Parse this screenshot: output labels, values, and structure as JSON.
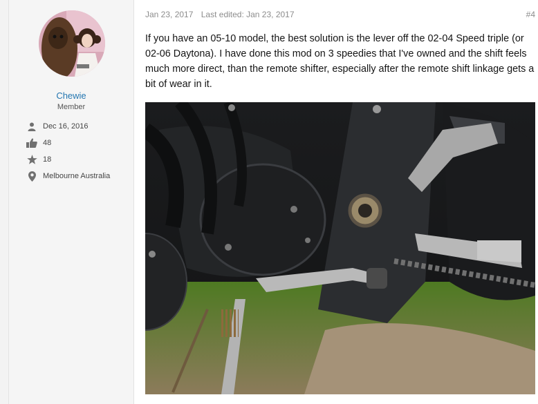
{
  "user": {
    "name": "Chewie",
    "title": "Member",
    "avatar_icon": "avatar-chewie-leia",
    "stats": [
      {
        "icon": "user-icon",
        "value": "Dec 16, 2016"
      },
      {
        "icon": "thumbs-up-icon",
        "value": "48"
      },
      {
        "icon": "star-icon",
        "value": "18"
      },
      {
        "icon": "location-pin-icon",
        "value": "Melbourne Australia"
      }
    ]
  },
  "post": {
    "date": "Jan 23, 2017",
    "edited": "Last edited: Jan 23, 2017",
    "number": "#4",
    "body": "If you have an 05-10 model, the best solution is the lever off the 02-04 Speed triple (or 02-06 Daytona). I have done this mod on 3 speedies that I've owned and the shift feels much more direct, than the remote shifter, especially after the remote shift linkage gets a bit of wear in it.",
    "image_icon": "motorcycle-shift-lever-photo"
  },
  "colors": {
    "link": "#2577b1",
    "muted": "#8c8c8c",
    "sidebar": "#f5f5f5"
  }
}
